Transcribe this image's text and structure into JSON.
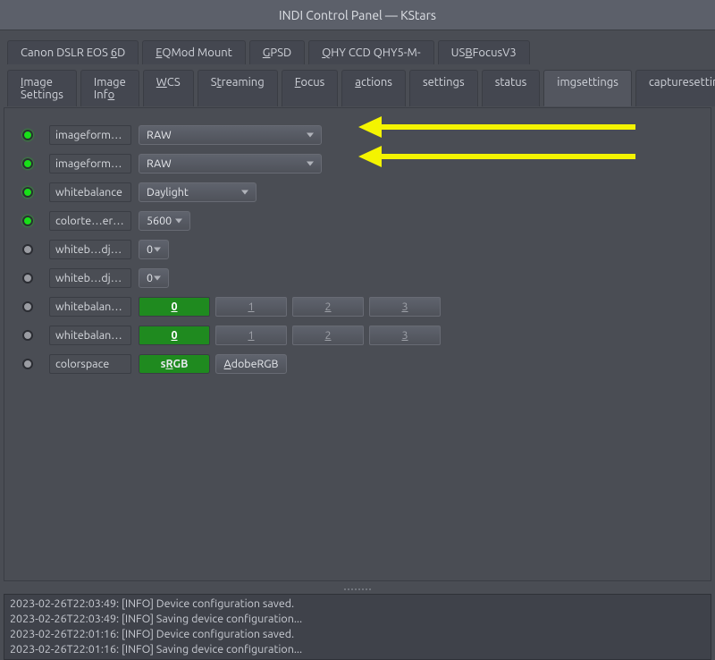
{
  "window": {
    "title": "INDI Control Panel — KStars"
  },
  "deviceTabs": [
    {
      "label_pre": "Canon DSLR EOS ",
      "accel": "6",
      "label_post": "D"
    },
    {
      "label_pre": "",
      "accel": "E",
      "label_post": "QMod Mount"
    },
    {
      "label_pre": "",
      "accel": "G",
      "label_post": "PSD"
    },
    {
      "label_pre": "",
      "accel": "Q",
      "label_post": "HY CCD QHY5-M-"
    },
    {
      "label_pre": "US",
      "accel": "B",
      "label_post": "FocusV3"
    }
  ],
  "subTabs": [
    {
      "label_pre": "",
      "accel": "I",
      "label_post": "mage Settings"
    },
    {
      "label_pre": "Image Inf",
      "accel": "o",
      "label_post": ""
    },
    {
      "label_pre": "",
      "accel": "W",
      "label_post": "CS"
    },
    {
      "label_pre": "S",
      "accel": "t",
      "label_post": "reaming"
    },
    {
      "label_pre": "",
      "accel": "F",
      "label_post": "ocus"
    },
    {
      "label_pre": "",
      "accel": "a",
      "label_post": "ctions"
    },
    {
      "label_pre": "settings",
      "accel": "",
      "label_post": ""
    },
    {
      "label_pre": "status",
      "accel": "",
      "label_post": ""
    },
    {
      "label_pre": "imgsettings",
      "accel": "",
      "label_post": "",
      "active": true
    },
    {
      "label_pre": "capturesettings",
      "accel": "",
      "label_post": ""
    }
  ],
  "rows": {
    "imgsd": {
      "label": "imageformatsd",
      "value": "RAW",
      "led": "green"
    },
    "imgcf": {
      "label": "imageformatcf",
      "value": "RAW",
      "led": "green"
    },
    "wb": {
      "label": "whitebalance",
      "value": "Daylight",
      "led": "green"
    },
    "ct": {
      "label": "colorte…erature",
      "value": "5600",
      "led": "green"
    },
    "wba": {
      "label": "whiteb…djusta",
      "value": "0",
      "led": "grey"
    },
    "wbb": {
      "label": "whiteb…djustb",
      "value": "0",
      "led": "grey"
    },
    "wbxa": {
      "label": "whitebalancexa",
      "val0": "0",
      "vals": [
        "1",
        "2",
        "3"
      ],
      "led": "grey"
    },
    "wbxb": {
      "label": "whitebalancexb",
      "val0": "0",
      "vals": [
        "1",
        "2",
        "3"
      ],
      "led": "grey"
    },
    "cs": {
      "label": "colorspace",
      "btn1_pre": "s",
      "btn1_accel": "R",
      "btn1_post": "GB",
      "btn2_pre": "",
      "btn2_accel": "A",
      "btn2_post": "dobeRGB",
      "led": "grey"
    }
  },
  "log": [
    "2023-02-26T22:03:49: [INFO] Device configuration saved.",
    "2023-02-26T22:03:49: [INFO] Saving device configuration...",
    "2023-02-26T22:01:16: [INFO] Device configuration saved.",
    "2023-02-26T22:01:16: [INFO] Saving device configuration..."
  ]
}
